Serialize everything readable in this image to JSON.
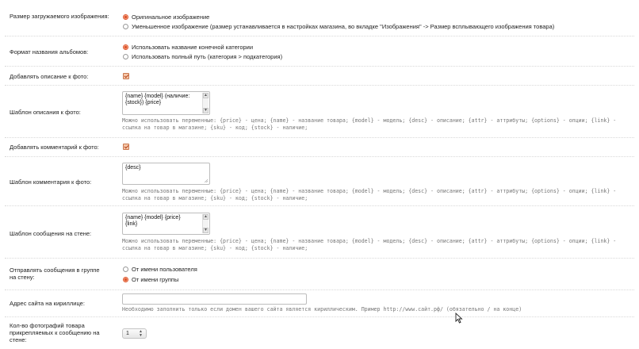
{
  "image_size": {
    "label": "Размер загружаемого изображения:",
    "options": [
      "Оригинальное изображение",
      "Уменьшенное изображение (размер устанавливается в настройках магазина, во вкладке \"Изображения\" -> Размер всплывающего изображения товара)"
    ],
    "selected": 0
  },
  "album_format": {
    "label": "Формат названия альбомов:",
    "options": [
      "Использовать название конечной категории",
      "Использовать полный путь (категория > подкатегория)"
    ],
    "selected": 0
  },
  "add_desc": {
    "label": "Добавлять описание к фото:",
    "checked": true
  },
  "desc_template": {
    "label": "Шаблон описания к фото:",
    "value": "{name} {model} (наличие: {stock}) {price}",
    "hint": "Можно использовать переменные: {price} - цена; {name} - название товара; {model} - модель; {desc} - описание; {attr} - аттрибуты; {options} - опции; {link} - ссылка на товар в магазине; {sku} - код; {stock} - наличие;"
  },
  "add_comment": {
    "label": "Добавлять комментарий к фото:",
    "checked": true
  },
  "comment_template": {
    "label": "Шаблон комментария к фото:",
    "value": "{desc}",
    "hint": "Можно использовать переменные: {price} - цена; {name} - название товара; {model} - модель; {desc} - описание; {attr} - аттрибуты; {options} - опции; {link} - ссылка на товар в магазине; {sku} - код; {stock} - наличие;"
  },
  "wall_template": {
    "label": "Шаблон сообщения на стене:",
    "value": "{name} {model} {price} {link}",
    "hint": "Можно использовать переменные: {price} - цена; {name} - название товара; {model} - модель; {desc} - описание; {attr} - аттрибуты; {options} - опции; {link} - ссылка на товар в магазине; {sku} - код; {stock} - наличие;"
  },
  "post_as": {
    "label": "Отправлять сообщения в группе на стену:",
    "options": [
      "От имени пользователя",
      "От имени группы"
    ],
    "selected": 1
  },
  "cyrillic_url": {
    "label": "Адрес сайта на кириллице:",
    "value": "",
    "hint": "Необходимо заполнить только если домен вашего сайта является кириллическим. Пример http://www.сайт.рф/ (обязательно / на конце)"
  },
  "photo_count": {
    "label": "Кол-во фотографий товара прикрепляемых к сообщению на стене:",
    "value": "1"
  },
  "colors": {
    "accent": "#e0562b",
    "hint": "#777777",
    "border": "#bdbdbd"
  }
}
